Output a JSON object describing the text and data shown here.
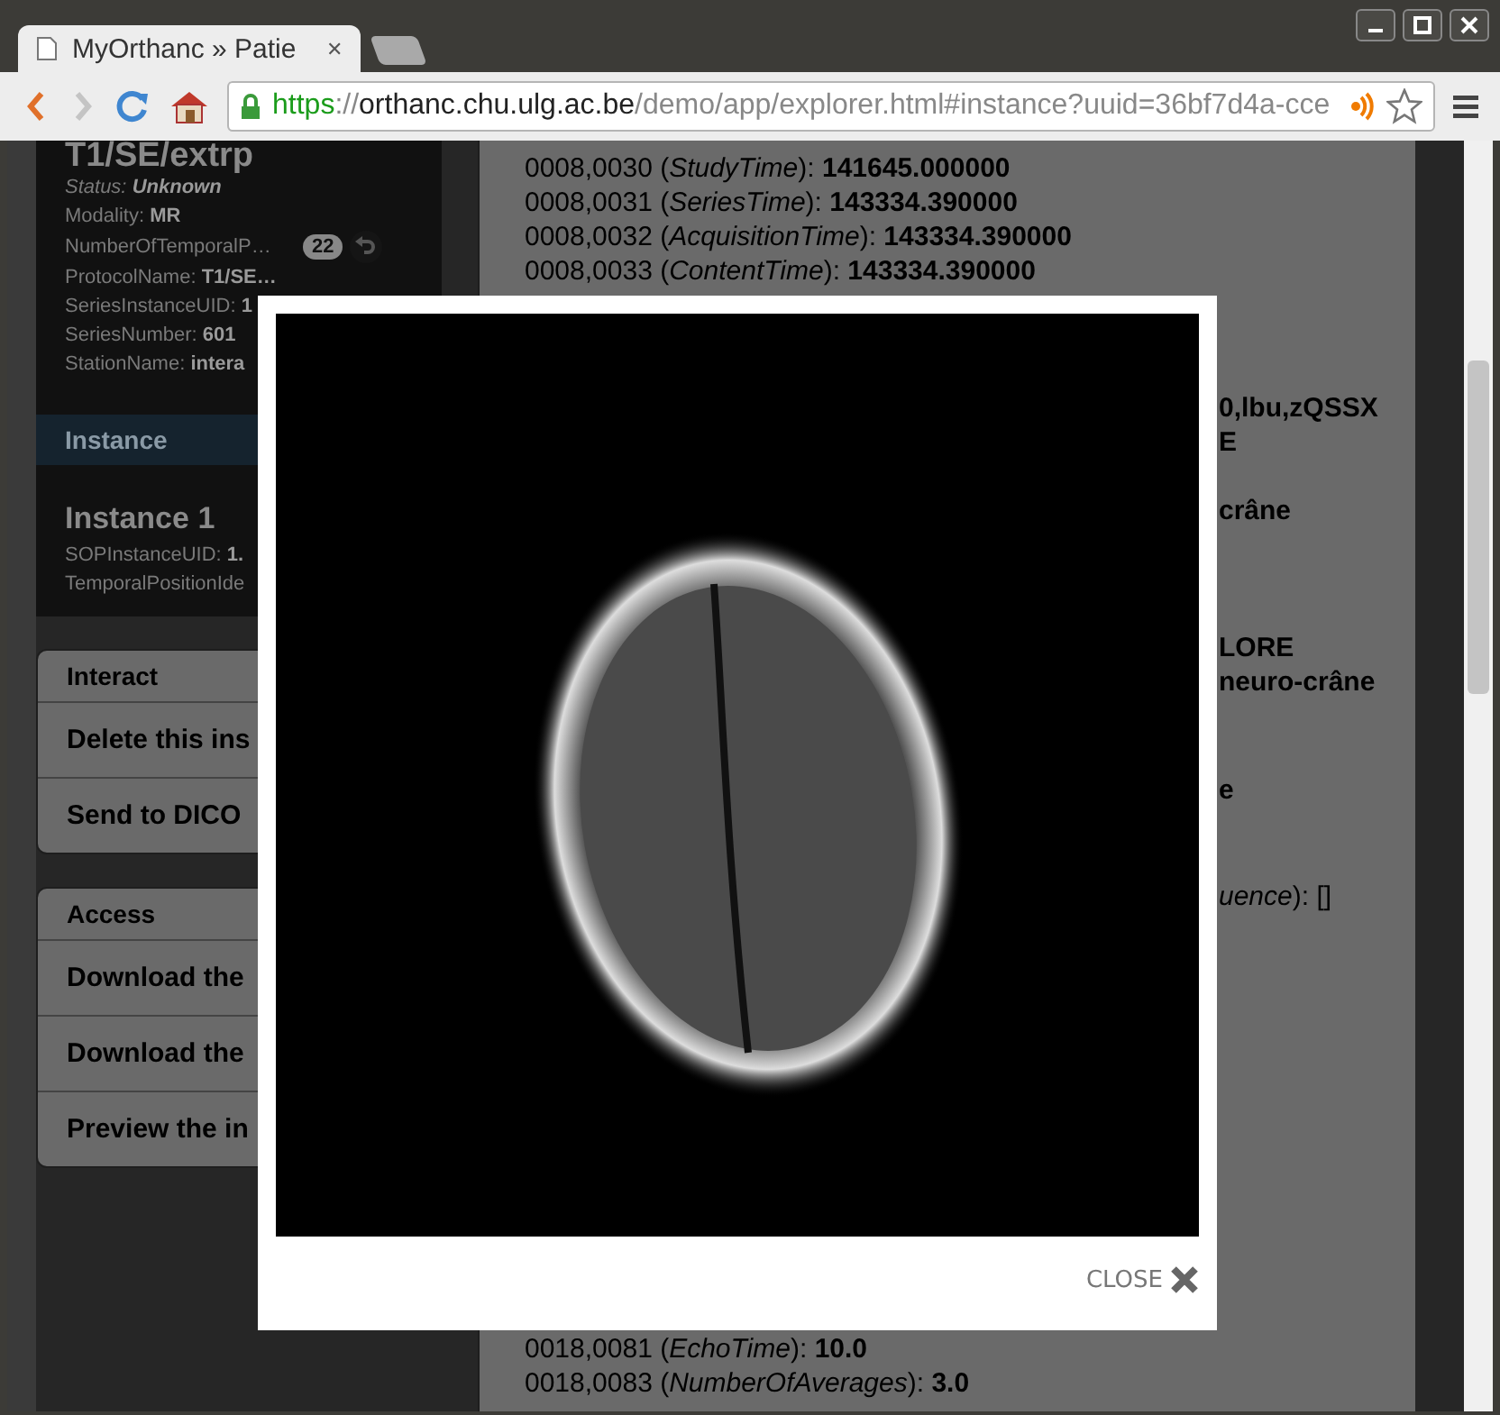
{
  "browser": {
    "tab_title": "MyOrthanc » Patie",
    "tab_close": "✕",
    "url_parts": [
      {
        "kind": "scheme",
        "text": "https"
      },
      {
        "kind": "sep",
        "text": "://"
      },
      {
        "kind": "host",
        "text": "orthanc.chu.ulg.ac.be"
      },
      {
        "kind": "path",
        "text": "/demo/app/explorer.html#instance?uuid=36bf7d4a-cce"
      }
    ]
  },
  "series": {
    "title": "T1/SE/extrp",
    "status_label": "Status:",
    "status_value": "Unknown",
    "fields": [
      {
        "text": "Modality: **MR**"
      },
      {
        "text": "NumberOfTemporalP…",
        "badge": "22"
      },
      {
        "text": "ProtocolName: **T1/SE…**"
      },
      {
        "text": "SeriesInstanceUID: **1**"
      },
      {
        "text": "SeriesNumber: **601**"
      },
      {
        "text": "StationName: **intera**"
      }
    ]
  },
  "instance": {
    "header": "Instance",
    "title": "Instance 1",
    "fields": [
      {
        "text": "SOPInstanceUID: **1.**"
      },
      {
        "text": "TemporalPositionIde"
      }
    ]
  },
  "panels": [
    {
      "header": "Interact",
      "items": [
        "Delete this ins",
        "Send to DICO"
      ]
    },
    {
      "header": "Access",
      "items": [
        "Download the",
        "Download the",
        "Preview the in"
      ]
    }
  ],
  "tags_top": [
    "0008,0030 (*StudyTime*): **141645.000000**",
    "0008,0031 (*SeriesTime*): **143334.390000**",
    "0008,0032 (*AcquisitionTime*): **143334.390000**",
    "0008,0033 (*ContentTime*): **143334.390000**"
  ],
  "tag_fragments": [
    [
      "**0,lbu,zQSSX**",
      "**E**"
    ],
    [
      "**crâne**"
    ],
    [
      "**LORE**",
      "**neuro-crâne**"
    ],
    [
      "**e**"
    ],
    [
      "*uence*): []"
    ]
  ],
  "tags_bottom": [
    "0018,0081 (*EchoTime*): **10.0**",
    "0018,0083 (*NumberOfAverages*): **3.0**"
  ],
  "viewer": {
    "close": "CLOSE"
  }
}
